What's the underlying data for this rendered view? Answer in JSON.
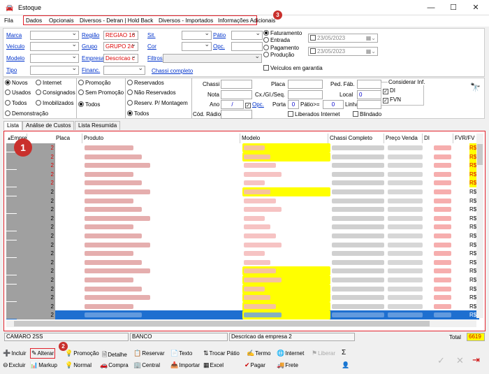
{
  "window": {
    "title": "Estoque",
    "min": "—",
    "max": "☐",
    "close": "✕"
  },
  "menu": {
    "fila": "Fila",
    "items": [
      "Dados",
      "Opcionais",
      "Diversos - Detran | Hold Back",
      "Diversos - Importados",
      "Informações Adicionais"
    ],
    "badge": "3"
  },
  "filters": {
    "marca": "Marca",
    "veiculo": "Veículo",
    "modelo": "Modelo",
    "tipo": "Tipo",
    "regiao": "Região",
    "regiao_val": "REGIAO 16",
    "grupo": "Grupo",
    "grupo_val": "GRUPO 24",
    "empresa": "Empresa",
    "empresa_val": "Descricao c",
    "financ": "Financ.",
    "sit": "Sit.",
    "cor": "Cor",
    "filtros": "Filtros",
    "chassi_completo": "Chassi completo",
    "patio": "Pátio",
    "opc": "Opc.",
    "date_radio": [
      "Faturamento",
      "Entrada",
      "Pagamento",
      "Produção"
    ],
    "date1": "23/05/2023",
    "date2": "23/05/2023",
    "garantia": "Veículos em garantia"
  },
  "options": {
    "col1": [
      "Novos",
      "Usados",
      "Todos",
      "Demonstração"
    ],
    "col2": [
      "Internet",
      "Consignados",
      "Imobilizados"
    ],
    "col3": [
      "Promoção",
      "Sem Promoção",
      "Todos"
    ],
    "col4": [
      "Reservados",
      "Não Reservados",
      "Reserv. P/ Montagem",
      "Todos"
    ],
    "chassi": "Chassi",
    "nota": "Nota",
    "ano": "Ano",
    "ano_val": "/",
    "opc": "Opc.",
    "cod_radio": "Cód. Rádio",
    "placa": "Placa",
    "cx": "Cx./Gl./Seq.",
    "porta": "Porta",
    "porta_val": "0",
    "patio_ge": "Pátio>=",
    "patio_val": "0",
    "ped_fab": "Ped. Fáb.",
    "local": "Local",
    "local_val": "0",
    "linha": "Linha",
    "liberados": "Liberados Internet",
    "blindado": "Blindado",
    "considerar": "Considerar Inf.",
    "di": "DI",
    "fvn": "FVN"
  },
  "tabs": [
    "Lista",
    "Análise de Custos",
    "Lista Resumida"
  ],
  "grid": {
    "badge": "1",
    "columns": [
      "Empresa",
      "Placa",
      "Produto",
      "Modelo",
      "Chassi Completo",
      "Preço Venda",
      "DI",
      "FVR/FV"
    ],
    "row_empresa_red": "2",
    "row_empresa": "2",
    "currency": "R$"
  },
  "status": {
    "cell1": "CAMARO 2SS",
    "cell2": "BANCO",
    "cell3": "Descricao da empresa 2",
    "total_label": "Total",
    "total_val": "6619"
  },
  "toolbar": {
    "badge": "2",
    "row1": [
      "Incluir",
      "Alterar",
      "Promoção",
      "Detalhe",
      "Reservar",
      "Texto",
      "Trocar Pátio",
      "Termo",
      "Internet",
      "Liberar",
      "Σ"
    ],
    "row2": [
      "Excluir",
      "Markup",
      "Normal",
      "Compra",
      "Central",
      "Importar",
      "Excel",
      "Pagar",
      "Frete"
    ]
  },
  "colors": {
    "accent_red": "#e2222c",
    "selection": "#1e6fd0",
    "highlight": "#ffff00"
  }
}
